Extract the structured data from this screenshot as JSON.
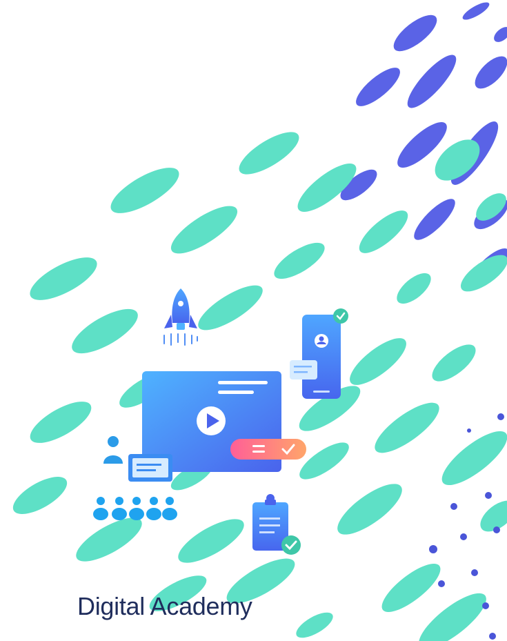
{
  "title": "Digital Academy",
  "colors": {
    "mint": "#5ee0c6",
    "indigo": "#5a63e6",
    "screen_top": "#4fa6ff",
    "screen_bottom": "#4a6cf0",
    "accent_pink": "#ff6d8c",
    "accent_orange": "#ff9a6a",
    "check_teal": "#3fc7a8",
    "title_text": "#1f2d5c"
  },
  "icons": [
    "rocket-icon",
    "smartphone-icon",
    "play-icon",
    "clipboard-icon",
    "people-icon",
    "checkmark-icon"
  ]
}
